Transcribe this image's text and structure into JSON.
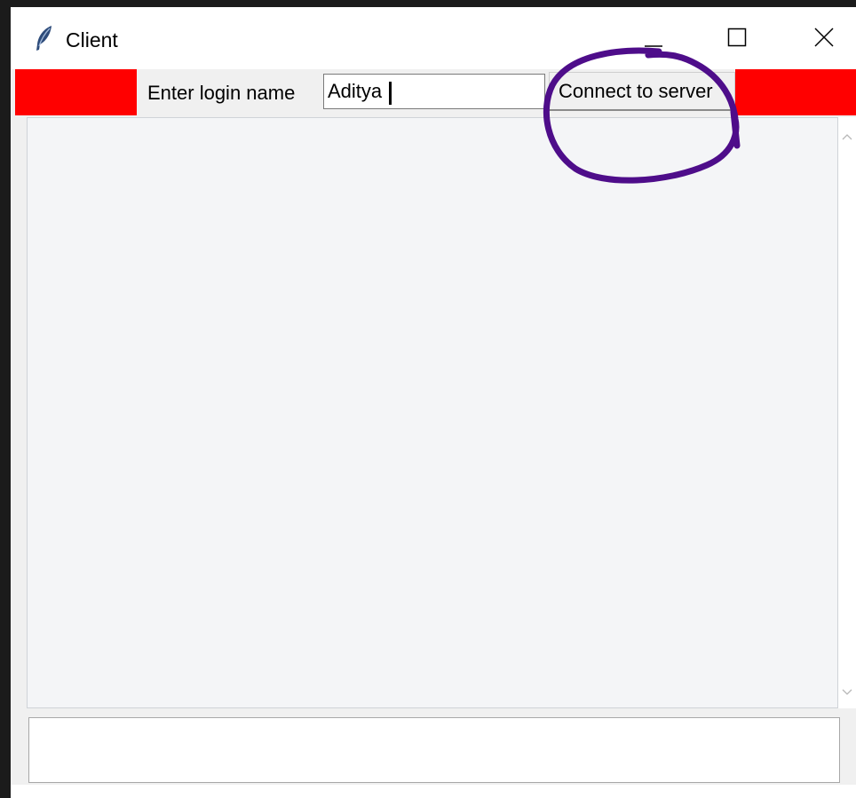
{
  "window": {
    "title": "Client",
    "icon": "feather-icon",
    "controls": [
      "minimize-icon",
      "maximize-icon",
      "close-icon"
    ]
  },
  "login": {
    "label": "Enter login name",
    "value": "Aditya",
    "button_label": "Connect to server"
  },
  "chat": {
    "message_input_value": ""
  },
  "colors": {
    "frame_red": "#ff0000",
    "annotation_purple": "#4e0d8a",
    "message_area_bg": "#f4f5f7"
  }
}
